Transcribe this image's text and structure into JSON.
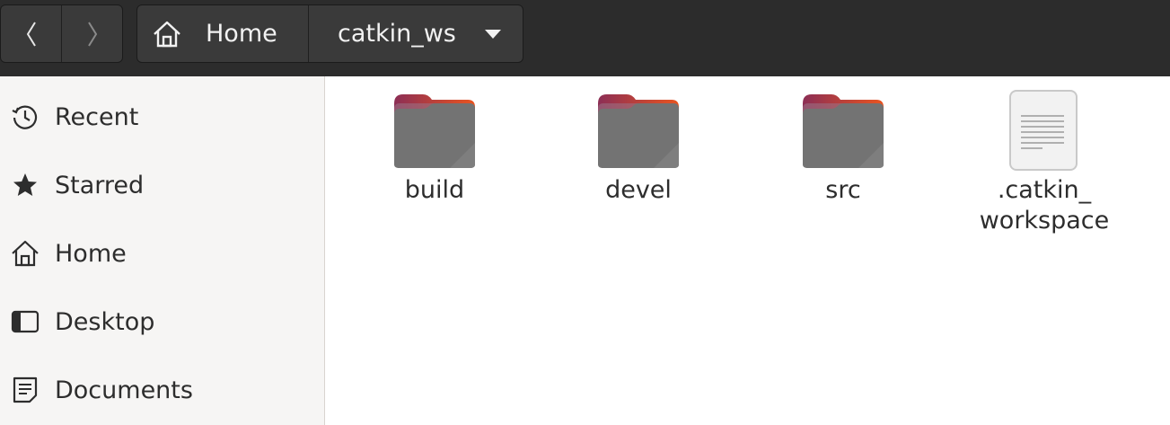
{
  "toolbar": {
    "back_icon": "chevron-left-icon",
    "forward_icon": "chevron-right-icon"
  },
  "path_bar": {
    "home_icon": "home-icon",
    "home_label": "Home",
    "current_label": "catkin_ws",
    "dropdown_icon": "triangle-down-icon"
  },
  "sidebar": {
    "items": [
      {
        "label": "Recent",
        "icon": "clock-icon"
      },
      {
        "label": "Starred",
        "icon": "star-icon"
      },
      {
        "label": "Home",
        "icon": "home-icon"
      },
      {
        "label": "Desktop",
        "icon": "desktop-icon"
      },
      {
        "label": "Documents",
        "icon": "document-icon"
      }
    ]
  },
  "files": [
    {
      "name": "build",
      "type": "folder"
    },
    {
      "name": "devel",
      "type": "folder"
    },
    {
      "name": "src",
      "type": "folder"
    },
    {
      "name": ".catkin_\nworkspace",
      "type": "text-file"
    }
  ],
  "colors": {
    "headerbar": "#2c2c2c",
    "sidebar": "#f6f5f4",
    "folder_body": "#737373",
    "folder_tab_magenta": "#8c2e55",
    "folder_tab_orange": "#e95420"
  }
}
